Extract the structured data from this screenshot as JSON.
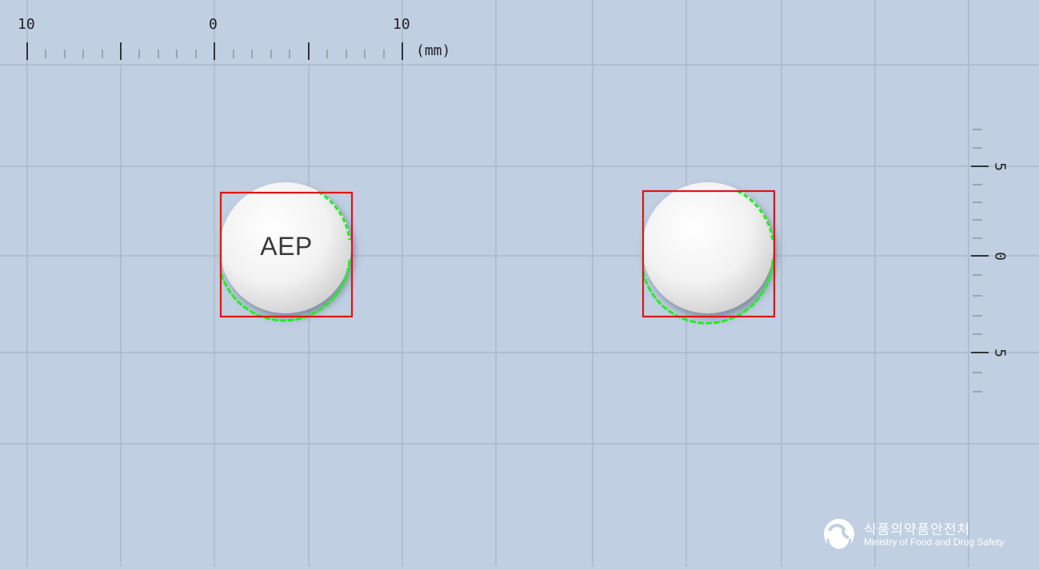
{
  "ruler": {
    "unit": "(mm)",
    "horizontal_labels": [
      "10",
      "0",
      "10"
    ],
    "vertical_labels": [
      "5",
      "0",
      "5"
    ]
  },
  "pills": [
    {
      "imprint": "AEP",
      "color": "#ffffff"
    },
    {
      "imprint": "",
      "color": "#ffffff"
    }
  ],
  "colors": {
    "background": "#c1cfe2",
    "grid_line": "#9fb0c6",
    "bounding_box": "#e01414",
    "contour": "#22ee22"
  },
  "logo": {
    "korean": "식품의약품안전처",
    "english": "Ministry of Food and Drug Safety",
    "icon": "taegeuk-swirl-icon"
  }
}
